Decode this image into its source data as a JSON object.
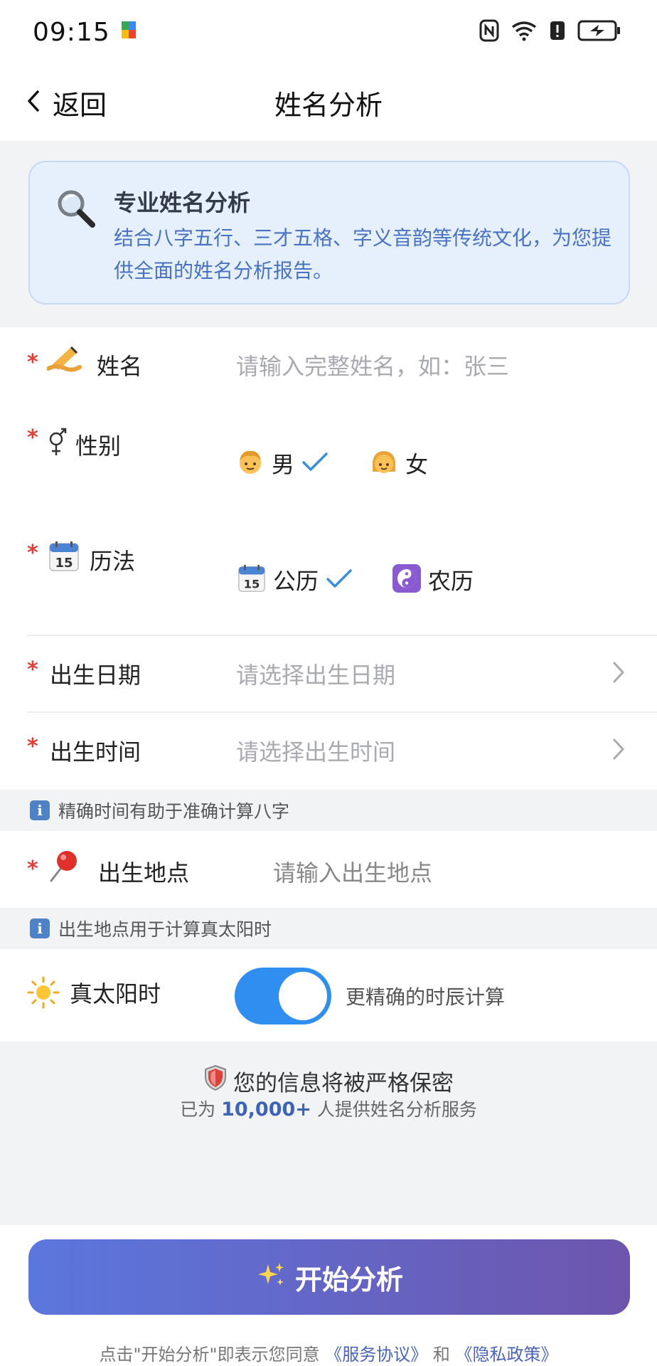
{
  "status_bar": {
    "time": "09:15"
  },
  "nav": {
    "back_label": "返回",
    "title": "姓名分析"
  },
  "intro": {
    "title": "专业姓名分析",
    "description": "结合八字五行、三才五格、字义音韵等传统文化，为您提供全面的姓名分析报告。"
  },
  "form": {
    "required_mark": "*",
    "name": {
      "label": "姓名",
      "placeholder": "请输入完整姓名，如：张三"
    },
    "gender": {
      "label": "性别",
      "options": [
        {
          "label": "男",
          "selected": true
        },
        {
          "label": "女",
          "selected": false
        }
      ]
    },
    "calendar": {
      "label": "历法",
      "options": [
        {
          "label": "公历",
          "selected": true
        },
        {
          "label": "农历",
          "selected": false
        }
      ]
    },
    "birth_date": {
      "label": "出生日期",
      "placeholder": "请选择出生日期"
    },
    "birth_time": {
      "label": "出生时间",
      "placeholder": "请选择出生时间"
    },
    "time_hint": "精确时间有助于准确计算八字",
    "birth_place": {
      "label": "出生地点",
      "placeholder": "请输入出生地点"
    },
    "place_hint": "出生地点用于计算真太阳时",
    "solar_time": {
      "label": "真太阳时",
      "enabled": true,
      "description": "更精确的时辰计算"
    }
  },
  "footer": {
    "secure_text": "您的信息将被严格保密",
    "served_prefix": "已为",
    "served_count": "10,000+",
    "served_suffix": "人提供姓名分析服务",
    "start_button": "开始分析",
    "agreement_prefix": "点击\"开始分析\"即表示您同意",
    "service_link": "《服务协议》",
    "agreement_and": "和",
    "privacy_link": "《隐私政策》"
  },
  "colors": {
    "accent_blue": "#2f8ef0",
    "required_red": "#e0403a",
    "button_gradient_start": "#5b77de",
    "button_gradient_end": "#6d55ad"
  }
}
